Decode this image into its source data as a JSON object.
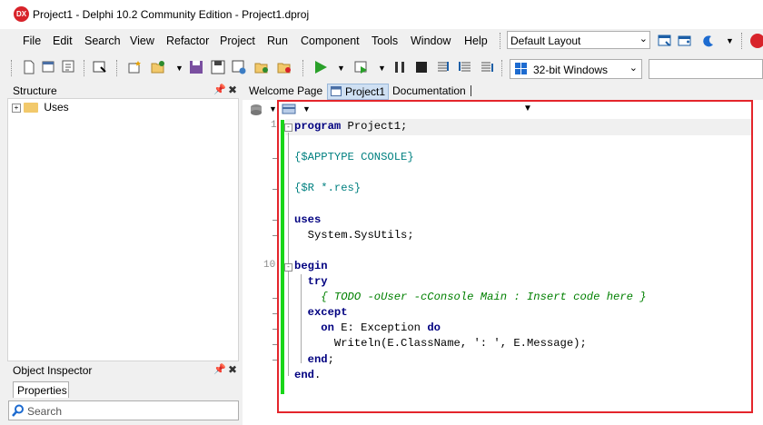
{
  "window": {
    "title": "Project1 - Delphi 10.2 Community Edition - Project1.dproj",
    "logo_text": "DX"
  },
  "menu": [
    "File",
    "Edit",
    "Search",
    "View",
    "Refactor",
    "Project",
    "Run",
    "Component",
    "Tools",
    "Window",
    "Help"
  ],
  "layout_select": {
    "value": "Default Layout"
  },
  "platform_select": {
    "value": "32-bit Windows"
  },
  "structure": {
    "title": "Structure",
    "tree": [
      {
        "label": "Uses",
        "expanded": false
      }
    ]
  },
  "object_inspector": {
    "title": "Object Inspector",
    "tab": "Properties",
    "search_placeholder": "Search"
  },
  "editor": {
    "tabs": [
      {
        "label": "Welcome Page",
        "active": false
      },
      {
        "label": "Project1",
        "active": true
      },
      {
        "label": "Documentation",
        "active": false
      }
    ],
    "line_numbers": [
      "1",
      "10"
    ],
    "code": [
      [
        {
          "t": "program",
          "c": "kw"
        },
        {
          "t": " Project1;",
          "c": "str"
        }
      ],
      [],
      [
        {
          "t": "{$APPTYPE CONSOLE}",
          "c": "dir"
        }
      ],
      [],
      [
        {
          "t": "{$R *.res}",
          "c": "dir"
        }
      ],
      [],
      [
        {
          "t": "uses",
          "c": "kw"
        }
      ],
      [
        {
          "t": "  System.SysUtils;",
          "c": "str"
        }
      ],
      [],
      [
        {
          "t": "begin",
          "c": "kw"
        }
      ],
      [
        {
          "t": "  ",
          "c": "str"
        },
        {
          "t": "try",
          "c": "kw"
        }
      ],
      [
        {
          "t": "    { TODO -oUser -cConsole Main : Insert code here }",
          "c": "cmt"
        }
      ],
      [
        {
          "t": "  ",
          "c": "str"
        },
        {
          "t": "except",
          "c": "kw"
        }
      ],
      [
        {
          "t": "    ",
          "c": "str"
        },
        {
          "t": "on",
          "c": "kw"
        },
        {
          "t": " E: Exception ",
          "c": "str"
        },
        {
          "t": "do",
          "c": "kw"
        }
      ],
      [
        {
          "t": "      Writeln(E.ClassName, ': ', E.Message);",
          "c": "str"
        }
      ],
      [
        {
          "t": "  ",
          "c": "str"
        },
        {
          "t": "end",
          "c": "kw"
        },
        {
          "t": ";",
          "c": "str"
        }
      ],
      [
        {
          "t": "end",
          "c": "kw"
        },
        {
          "t": ".",
          "c": "str"
        }
      ]
    ]
  },
  "colors": {
    "highlight_frame": "#e4252b",
    "modified_bar": "#19d619",
    "keyword": "#000080",
    "directive": "#008080",
    "comment": "#008000"
  }
}
